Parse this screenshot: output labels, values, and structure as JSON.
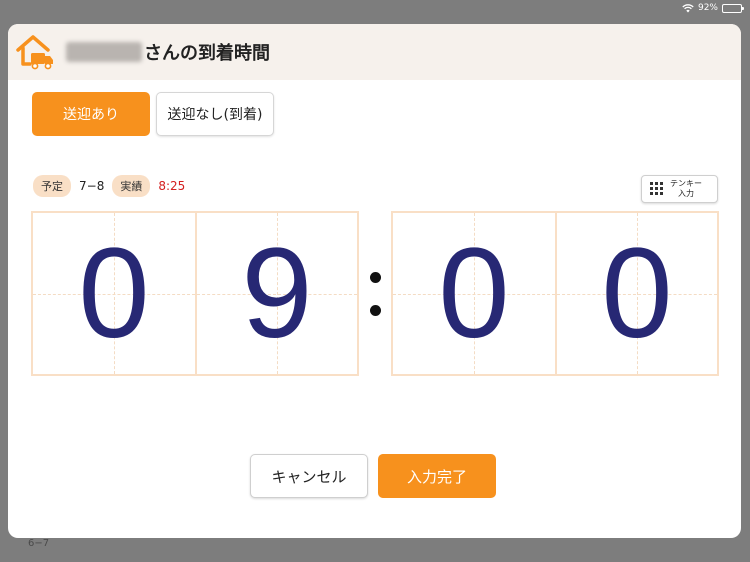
{
  "status_bar": {
    "battery": "92%"
  },
  "background": {
    "row_label": "6−7"
  },
  "header": {
    "title_suffix": "さんの到着時間",
    "icon": "home-truck-icon"
  },
  "mode": {
    "active_label": "送迎あり",
    "inactive_label": "送迎なし(到着)"
  },
  "info": {
    "scheduled_label": "予定",
    "scheduled_value": "7−8",
    "actual_label": "実績",
    "actual_value": "8:25"
  },
  "tenkey": {
    "line1": "テンキー",
    "line2": "入力"
  },
  "time": {
    "d1": "0",
    "d2": "9",
    "d3": "0",
    "d4": "0"
  },
  "buttons": {
    "cancel": "キャンセル",
    "done": "入力完了"
  },
  "colors": {
    "accent": "#f7911d",
    "digit": "#272874",
    "actual": "#d42020",
    "pill_bg": "#f9dfc6"
  }
}
